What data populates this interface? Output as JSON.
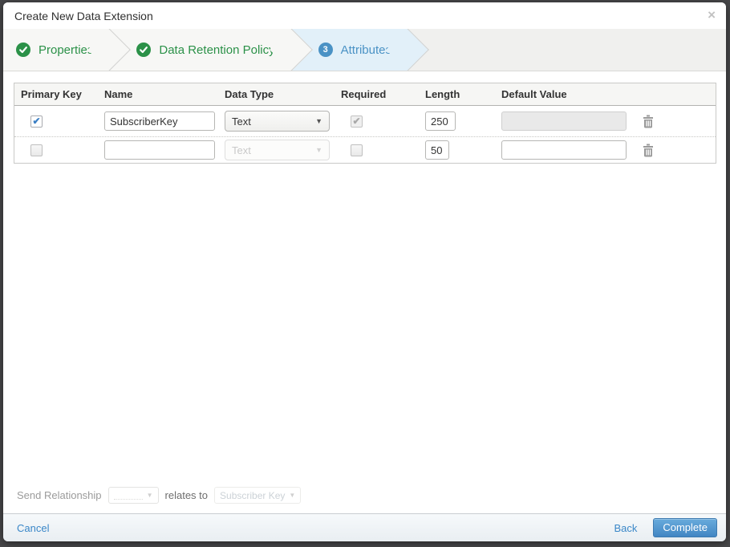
{
  "modal": {
    "title": "Create New Data Extension",
    "close_glyph": "×"
  },
  "wizard": {
    "steps": [
      {
        "label": "Properties",
        "status": "complete",
        "icon": "check-icon"
      },
      {
        "label": "Data Retention Policy",
        "status": "complete",
        "icon": "check-icon"
      },
      {
        "label": "Attributes",
        "status": "active",
        "number": "3"
      }
    ]
  },
  "table": {
    "headers": [
      "Primary Key",
      "Name",
      "Data Type",
      "Required",
      "Length",
      "Default Value",
      ""
    ],
    "rows": [
      {
        "primary_key_checked": true,
        "name": "SubscriberKey",
        "data_type": "Text",
        "data_type_disabled": false,
        "required_checked": true,
        "required_disabled": true,
        "length": "250",
        "default_value": "",
        "default_value_disabled": true
      },
      {
        "primary_key_checked": false,
        "name": "",
        "data_type": "Text",
        "data_type_disabled": true,
        "required_checked": false,
        "required_disabled": false,
        "length": "50",
        "default_value": "",
        "default_value_disabled": false
      }
    ],
    "check_glyph": "✔",
    "dropdown_arrow_glyph": "▼"
  },
  "send_relationship": {
    "label": "Send Relationship",
    "relates_label": "relates to",
    "target_value": "Subscriber Key",
    "arrow_glyph": "▼"
  },
  "footer": {
    "cancel_label": "Cancel",
    "back_label": "Back",
    "complete_label": "Complete"
  },
  "colors": {
    "step_complete_green": "#2b9148",
    "step_active_blue": "#4a92c5",
    "link_blue": "#3a87c8",
    "complete_button_blue": "#4286c3",
    "backdrop": "#48484a"
  }
}
